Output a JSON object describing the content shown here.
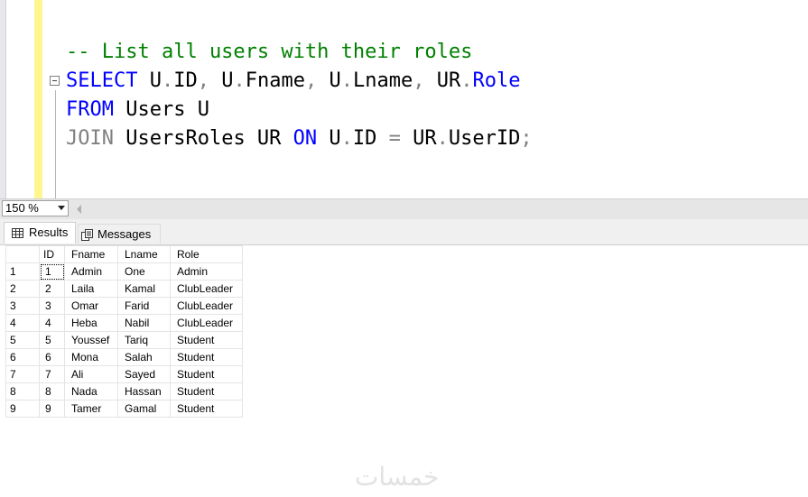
{
  "editor": {
    "comment": "-- List all users with their roles",
    "line2": {
      "select": "SELECT",
      "u1": "U",
      "dot1": ".",
      "id": "ID",
      "comma1": ",",
      "u2": "U",
      "dot2": ".",
      "fname": "Fname",
      "comma2": ",",
      "u3": "U",
      "dot3": ".",
      "lname": "Lname",
      "comma3": ",",
      "ur": "UR",
      "dot4": ".",
      "role": "Role"
    },
    "line3": {
      "from": "FROM",
      "users": "Users U"
    },
    "line4": {
      "join": "JOIN",
      "usersroles": "UsersRoles UR",
      "on": "ON",
      "u": "U",
      "dot1": ".",
      "id": "ID",
      "eq": "=",
      "ur": "UR",
      "dot2": ".",
      "userid": "UserID",
      "semi": ";"
    }
  },
  "zoom": {
    "value": "150 %"
  },
  "tabs": {
    "results": "Results",
    "messages": "Messages"
  },
  "grid": {
    "columns": [
      "ID",
      "Fname",
      "Lname",
      "Role"
    ],
    "rows": [
      {
        "n": "1",
        "id": "1",
        "fname": "Admin",
        "lname": "One",
        "role": "Admin"
      },
      {
        "n": "2",
        "id": "2",
        "fname": "Laila",
        "lname": "Kamal",
        "role": "ClubLeader"
      },
      {
        "n": "3",
        "id": "3",
        "fname": "Omar",
        "lname": "Farid",
        "role": "ClubLeader"
      },
      {
        "n": "4",
        "id": "4",
        "fname": "Heba",
        "lname": "Nabil",
        "role": "ClubLeader"
      },
      {
        "n": "5",
        "id": "5",
        "fname": "Youssef",
        "lname": "Tariq",
        "role": "Student"
      },
      {
        "n": "6",
        "id": "6",
        "fname": "Mona",
        "lname": "Salah",
        "role": "Student"
      },
      {
        "n": "7",
        "id": "7",
        "fname": "Ali",
        "lname": "Sayed",
        "role": "Student"
      },
      {
        "n": "8",
        "id": "8",
        "fname": "Nada",
        "lname": "Hassan",
        "role": "Student"
      },
      {
        "n": "9",
        "id": "9",
        "fname": "Tamer",
        "lname": "Gamal",
        "role": "Student"
      }
    ]
  },
  "watermark": "خمسات",
  "icons": {
    "collapse": "collapse-minus-icon",
    "results": "grid-icon",
    "messages": "messages-icon",
    "dropdown": "chevron-down-icon",
    "scroll": "scroll-left-icon"
  }
}
